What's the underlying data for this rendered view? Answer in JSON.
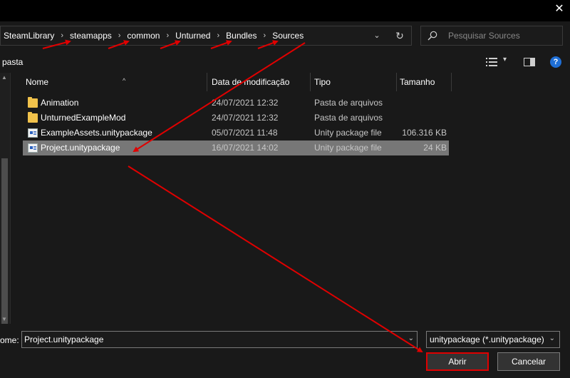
{
  "window": {
    "close_glyph": "✕"
  },
  "address": {
    "crumbs": [
      "SteamLibrary",
      "steamapps",
      "common",
      "Unturned",
      "Bundles",
      "Sources"
    ],
    "separator": "›",
    "dropdown_glyph": "⌄",
    "refresh_glyph": "↻"
  },
  "search": {
    "placeholder": "Pesquisar Sources"
  },
  "toolbar": {
    "new_folder_label": "pasta",
    "view_chevron": "▾",
    "help_glyph": "?"
  },
  "columns": {
    "name": "Nome",
    "modified": "Data de modificação",
    "type": "Tipo",
    "size": "Tamanho",
    "sort_caret": "^"
  },
  "files": [
    {
      "name": "Animation",
      "modified": "24/07/2021 12:32",
      "type": "Pasta de arquivos",
      "size": "",
      "icon": "folder-icon",
      "selected": false
    },
    {
      "name": "UnturnedExampleMod",
      "modified": "24/07/2021 12:32",
      "type": "Pasta de arquivos",
      "size": "",
      "icon": "folder-icon",
      "selected": false
    },
    {
      "name": "ExampleAssets.unitypackage",
      "modified": "05/07/2021 11:48",
      "type": "Unity package file",
      "size": "106.316 KB",
      "icon": "unitypackage-icon",
      "selected": false
    },
    {
      "name": "Project.unitypackage",
      "modified": "16/07/2021 14:02",
      "type": "Unity package file",
      "size": "24 KB",
      "icon": "unitypackage-icon",
      "selected": true
    }
  ],
  "bottom": {
    "filename_label": "ome:",
    "filename_value": "Project.unitypackage",
    "filter_value": "unitypackage (*.unitypackage)",
    "dropdown_glyph": "⌄",
    "open_label": "Abrir",
    "cancel_label": "Cancelar"
  },
  "annotation_color": "#e00000"
}
